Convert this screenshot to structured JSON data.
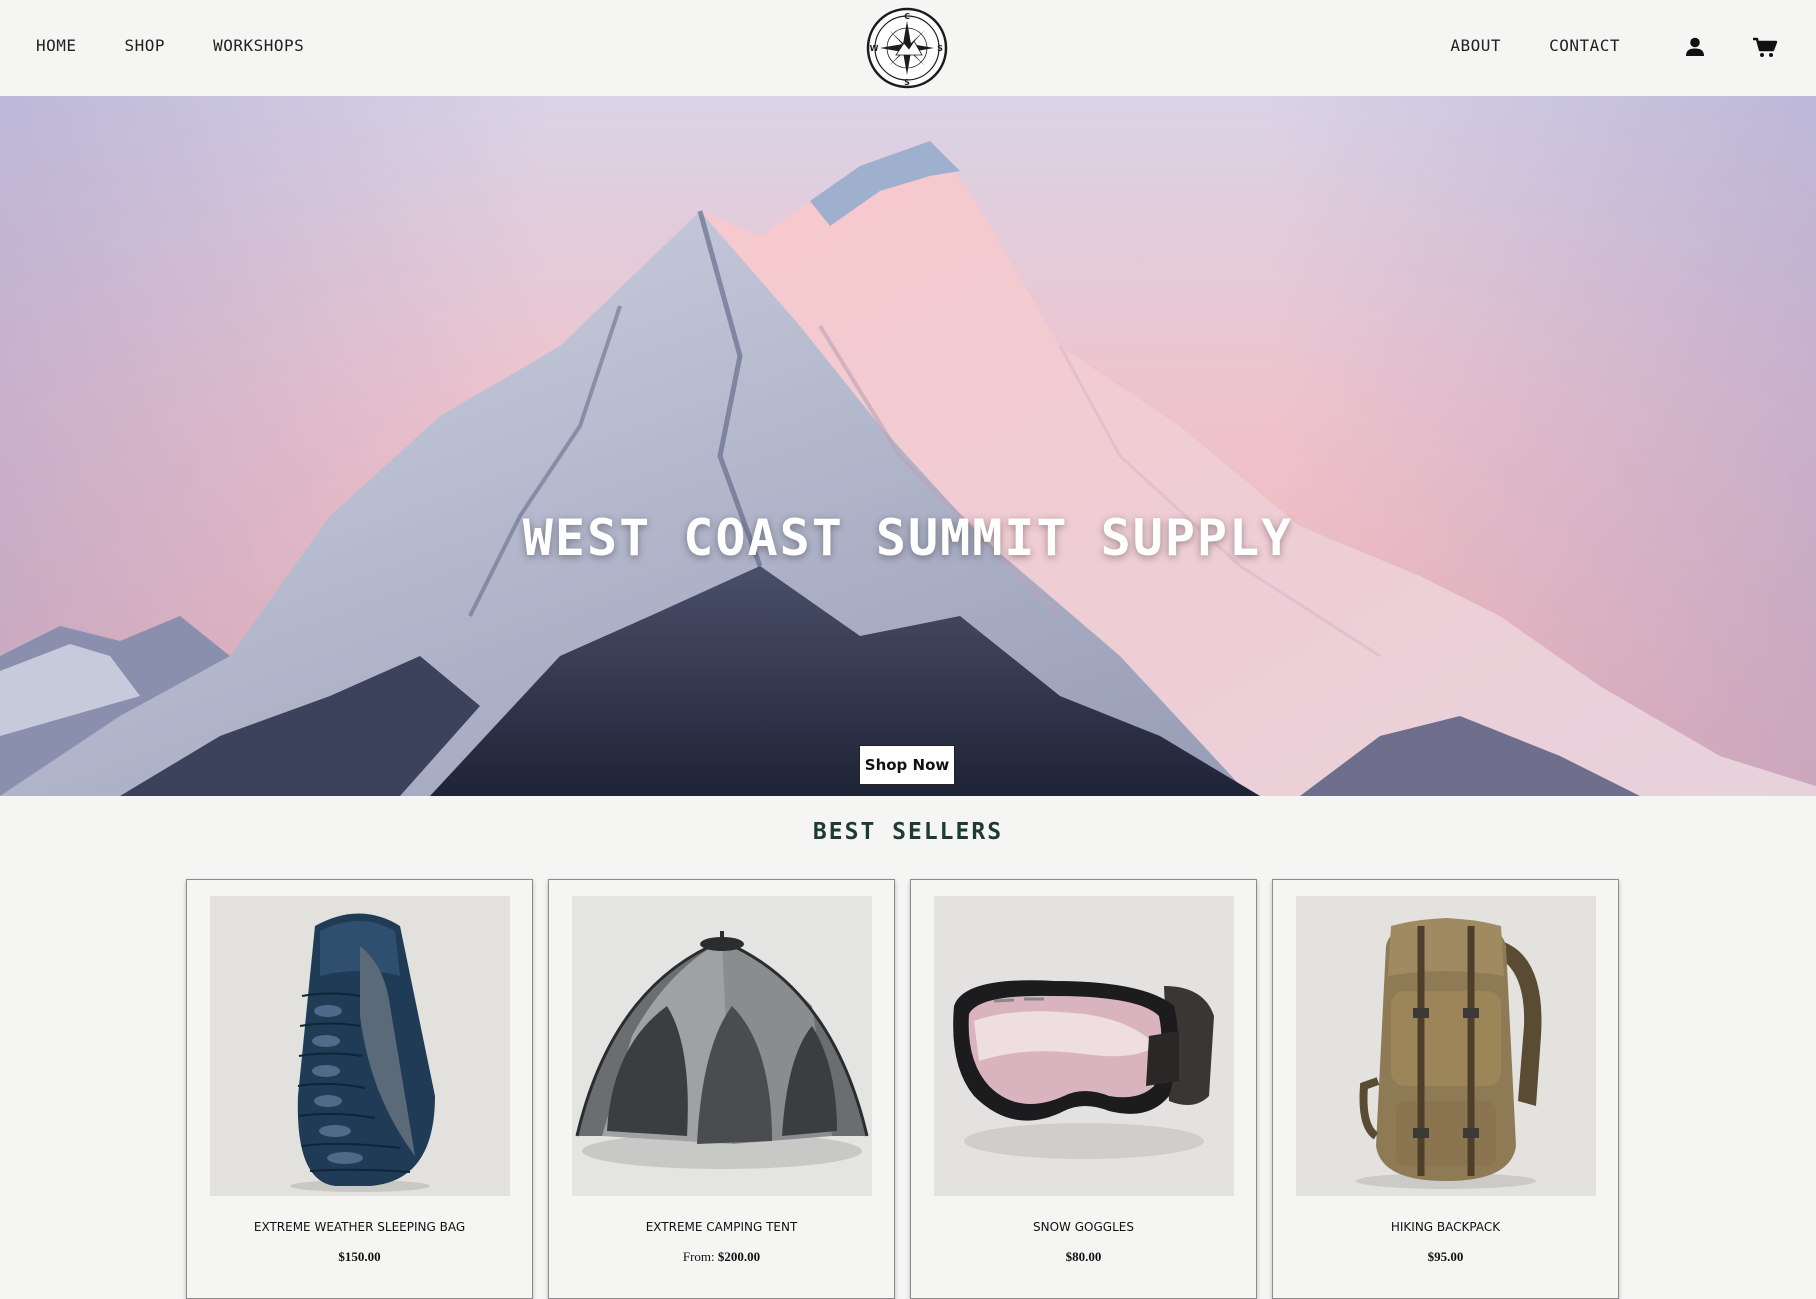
{
  "nav": {
    "left": [
      "HOME",
      "SHOP",
      "WORKSHOPS"
    ],
    "right": [
      "ABOUT",
      "CONTACT"
    ]
  },
  "logo": {
    "icon": "compass-logo-icon",
    "letters": {
      "n": "C",
      "w": "W",
      "e": "S",
      "s": "S"
    }
  },
  "icons": {
    "account": "user-icon",
    "cart": "cart-icon"
  },
  "hero": {
    "title": "WEST COAST SUMMIT SUPPLY",
    "button": "Shop Now"
  },
  "best_sellers": {
    "title": "BEST SELLERS",
    "products": [
      {
        "name": "EXTREME WEATHER SLEEPING BAG",
        "price_prefix": "",
        "price": "$150.00"
      },
      {
        "name": "EXTREME CAMPING TENT",
        "price_prefix": "From:",
        "price": "$200.00"
      },
      {
        "name": "SNOW GOGGLES",
        "price_prefix": "",
        "price": "$80.00"
      },
      {
        "name": "HIKING BACKPACK",
        "price_prefix": "",
        "price": "$95.00"
      }
    ]
  },
  "colors": {
    "background": "#f5f5f4",
    "section_title": "#1e3a34",
    "sky_top": "#d9d3e6",
    "sky_bottom": "#f2b2b4"
  }
}
